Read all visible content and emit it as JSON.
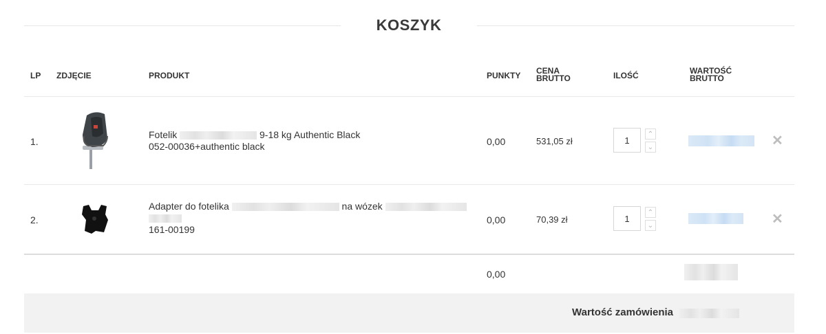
{
  "cart": {
    "title": "KOSZYK",
    "columns": {
      "lp": "LP",
      "photo": "ZDJĘCIE",
      "product": "PRODUKT",
      "points": "PUNKTY",
      "price_line1": "CENA",
      "price_line2": "BRUTTO",
      "qty": "ILOŚĆ",
      "value_line1": "WARTOŚĆ",
      "value_line2": "BRUTTO"
    },
    "items": [
      {
        "lp": "1.",
        "name_prefix": "Fotelik",
        "name_suffix": "9-18 kg Authentic Black",
        "sku": "052-00036+authentic black",
        "points": "0,00",
        "price": "531,05 zł",
        "qty": "1",
        "image_icon": "car-seat-icon"
      },
      {
        "lp": "2.",
        "name_prefix": "Adapter do fotelika",
        "name_middle": "na wózek",
        "sku": "161-00199",
        "points": "0,00",
        "price": "70,39 zł",
        "qty": "1",
        "image_icon": "adapter-icon"
      }
    ],
    "total_points": "0,00",
    "order_value_label": "Wartość zamówienia",
    "icons": {
      "remove": "close-icon",
      "up": "chevron-up-icon",
      "down": "chevron-down-icon"
    }
  }
}
